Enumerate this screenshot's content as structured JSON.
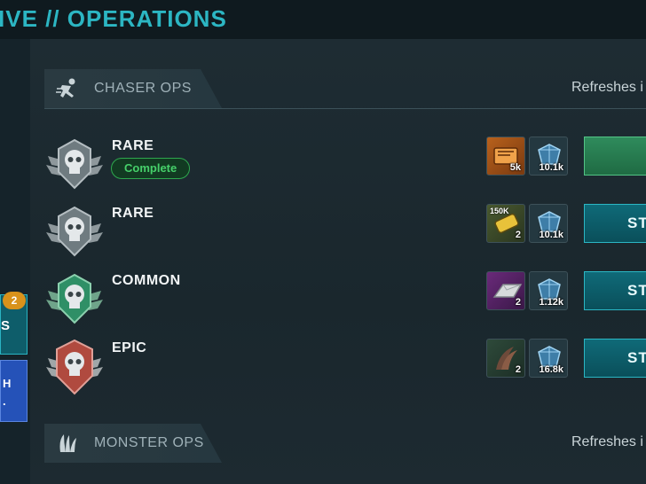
{
  "header": {
    "title": "IVE // OPERATIONS"
  },
  "rail": {
    "button_1": {
      "label": "S",
      "badge": "2"
    },
    "button_2": {
      "label_line1": "H",
      "label_line2": "."
    }
  },
  "sections": [
    {
      "title": "CHASER OPS",
      "refresh": "Refreshes i",
      "icon": "chaser-figure-icon"
    },
    {
      "title": "MONSTER OPS",
      "refresh": "Refreshes i",
      "icon": "monster-claw-icon"
    }
  ],
  "ops": [
    {
      "rarity": "RARE",
      "status": "Complete",
      "badge_color": "#9aa4a8",
      "rewards": [
        {
          "icon": "ticket-crate-icon",
          "qty": "5k"
        },
        {
          "icon": "blue-gem-icon",
          "qty": "10.1k"
        }
      ],
      "button": ""
    },
    {
      "rarity": "RARE",
      "status": "",
      "badge_color": "#9aa4a8",
      "rewards": [
        {
          "icon": "battery-150k-icon",
          "qty": "2",
          "tag": "150K"
        },
        {
          "icon": "blue-gem-icon",
          "qty": "10.1k"
        }
      ],
      "button": "ST"
    },
    {
      "rarity": "COMMON",
      "status": "",
      "badge_color": "#2f8f66",
      "rewards": [
        {
          "icon": "metal-ingot-icon",
          "qty": "2"
        },
        {
          "icon": "blue-gem-icon",
          "qty": "1.12k"
        }
      ],
      "button": "ST"
    },
    {
      "rarity": "EPIC",
      "status": "",
      "badge_color": "#b04a3f",
      "rewards": [
        {
          "icon": "claw-trophy-icon",
          "qty": "2"
        },
        {
          "icon": "blue-gem-icon",
          "qty": "16.8k"
        }
      ],
      "button": "ST"
    }
  ]
}
